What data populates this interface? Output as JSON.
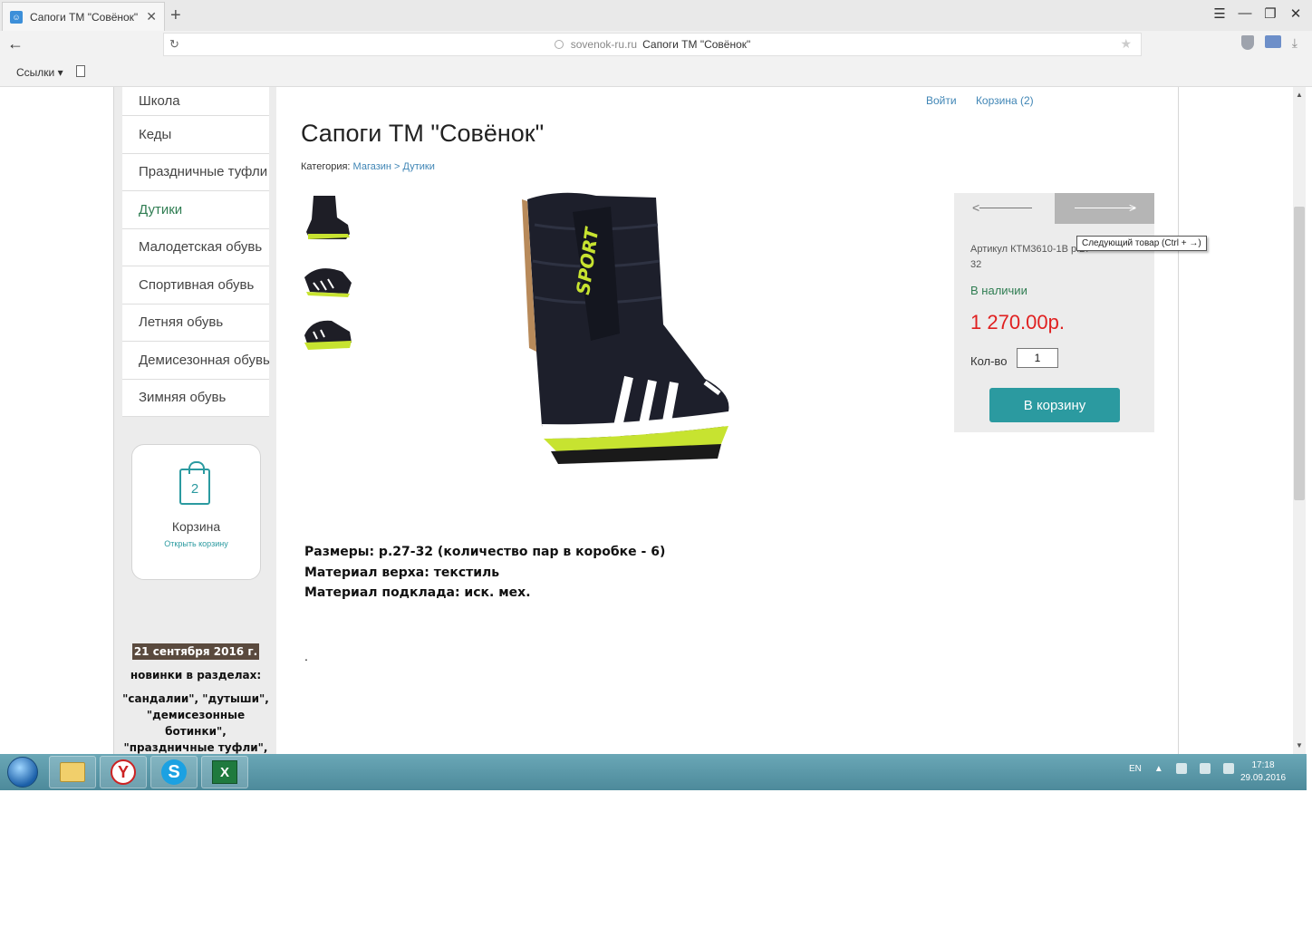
{
  "browser": {
    "tab_title": "Сапоги ТМ \"Совёнок\"",
    "tab_close": "✕",
    "new_tab": "+",
    "url_host": "sovenok-ru.ru",
    "url_title": "Сапоги ТМ \"Совёнок\"",
    "bookmarks_label": "Ссылки ▾"
  },
  "header": {
    "login": "Войти",
    "cart": "Корзина (2)"
  },
  "sidebar": {
    "menu": [
      {
        "label": "Школа"
      },
      {
        "label": "Кеды"
      },
      {
        "label": "Праздничные туфли"
      },
      {
        "label": "Дутики",
        "active": true
      },
      {
        "label": "Малодетская обувь"
      },
      {
        "label": "Спортивная обувь"
      },
      {
        "label": "Летняя обувь"
      },
      {
        "label": "Демисезонная обувь"
      },
      {
        "label": "Зимняя обувь"
      }
    ],
    "cart_widget": {
      "count": "2",
      "title": "Корзина",
      "link": "Открыть корзину"
    },
    "news": {
      "date": "21 сентября 2016 г.",
      "line1": "новинки в разделах:",
      "line2": "\"сандалии\", \"дутыши\", \"демисезонные ботинки\", \"праздничные туфли\","
    }
  },
  "product": {
    "title": "Сапоги ТМ \"Совёнок\"",
    "category_label": "Категория:",
    "category_path": [
      "Магазин",
      "Дутики"
    ],
    "crumb_sep": ">",
    "sku_line": "Артикул КТМ3610-1В р.27-",
    "sku_line2": "32",
    "stock": "В наличии",
    "price": "1 270.00р.",
    "qty_label": "Кол-во",
    "qty_value": "1",
    "buy_button": "В корзину",
    "next_tooltip": "Следующий товар (Ctrl + →)",
    "description": [
      "Размеры: р.27-32 (количество пар в коробке - 6)",
      "Материал верха: текстиль",
      "Материал подклада: иск. мех."
    ],
    "trailing_dot": "."
  },
  "taskbar": {
    "lang": "EN",
    "time": "17:18",
    "date": "29.09.2016"
  },
  "colors": {
    "accent": "#2b9aa0",
    "link": "#3f85b5",
    "price": "#e02020",
    "stock": "#2f7d52"
  }
}
